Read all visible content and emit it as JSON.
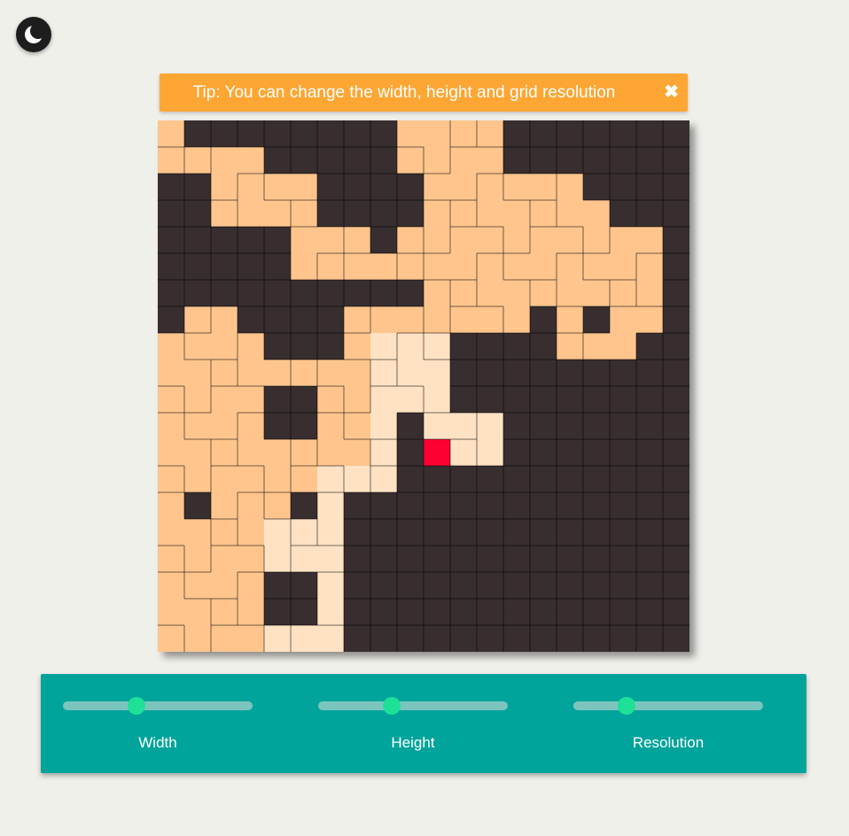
{
  "theme_toggle": {
    "icon": "moon-icon"
  },
  "tip": {
    "text": "Tip: You can change the width, height and grid resolution",
    "close": "✖"
  },
  "maze": {
    "rows": 20,
    "cols": 20,
    "legend": {
      "W": "wall",
      "P": "path",
      "V": "visited",
      "C": "current"
    },
    "colors": {
      "wall": "#382e2f",
      "path": "#ffc58d",
      "visited": "#ffe2c4",
      "current": "#ff0033",
      "grid_line": "#000000"
    },
    "grid": [
      "PWWWWWWWWPPPPWWWWWWW",
      "PPPPWWWWWPPPPWWWWWWW",
      "WWPPPPWWWWPPPPPPWWWW",
      "WWPPPPWWWWPPPPPPPWWW",
      "WWWWWPPPWPPPPPPPPPPW",
      "WWWWWPPPPPPPPPPPPPPW",
      "WWWWWWWWWWPPPPPPPPPW",
      "WPPWWWWPPPPPPPWPWPPW",
      "PPPPWWWPVVVWWWWPPPWW",
      "PPPPPPPPVVVWWWWWWWWW",
      "PPPPWWPPVVVWWWWWWWWW",
      "PPPPWWPPVWVVVWWWWWWW",
      "PPPPPPPPVWCVVWWWWWWW",
      "PPPPPPVVVWWWWWWWWWWW",
      "PWPPPWVWWWWWWWWWWWWW",
      "PPPPVVVWWWWWWWWWWWWW",
      "PPPPVVVWWWWWWWWWWWWW",
      "PPPPWWVWWWWWWWWWWWWW",
      "PPPPWWVWWWWWWWWWWWWW",
      "PPPPVVVWWWWWWWWWWWWW"
    ]
  },
  "controls": {
    "accent": "#00a49a",
    "sliders": [
      {
        "label": "Width",
        "value": 0.39
      },
      {
        "label": "Height",
        "value": 0.39
      },
      {
        "label": "Resolution",
        "value": 0.28
      }
    ]
  }
}
